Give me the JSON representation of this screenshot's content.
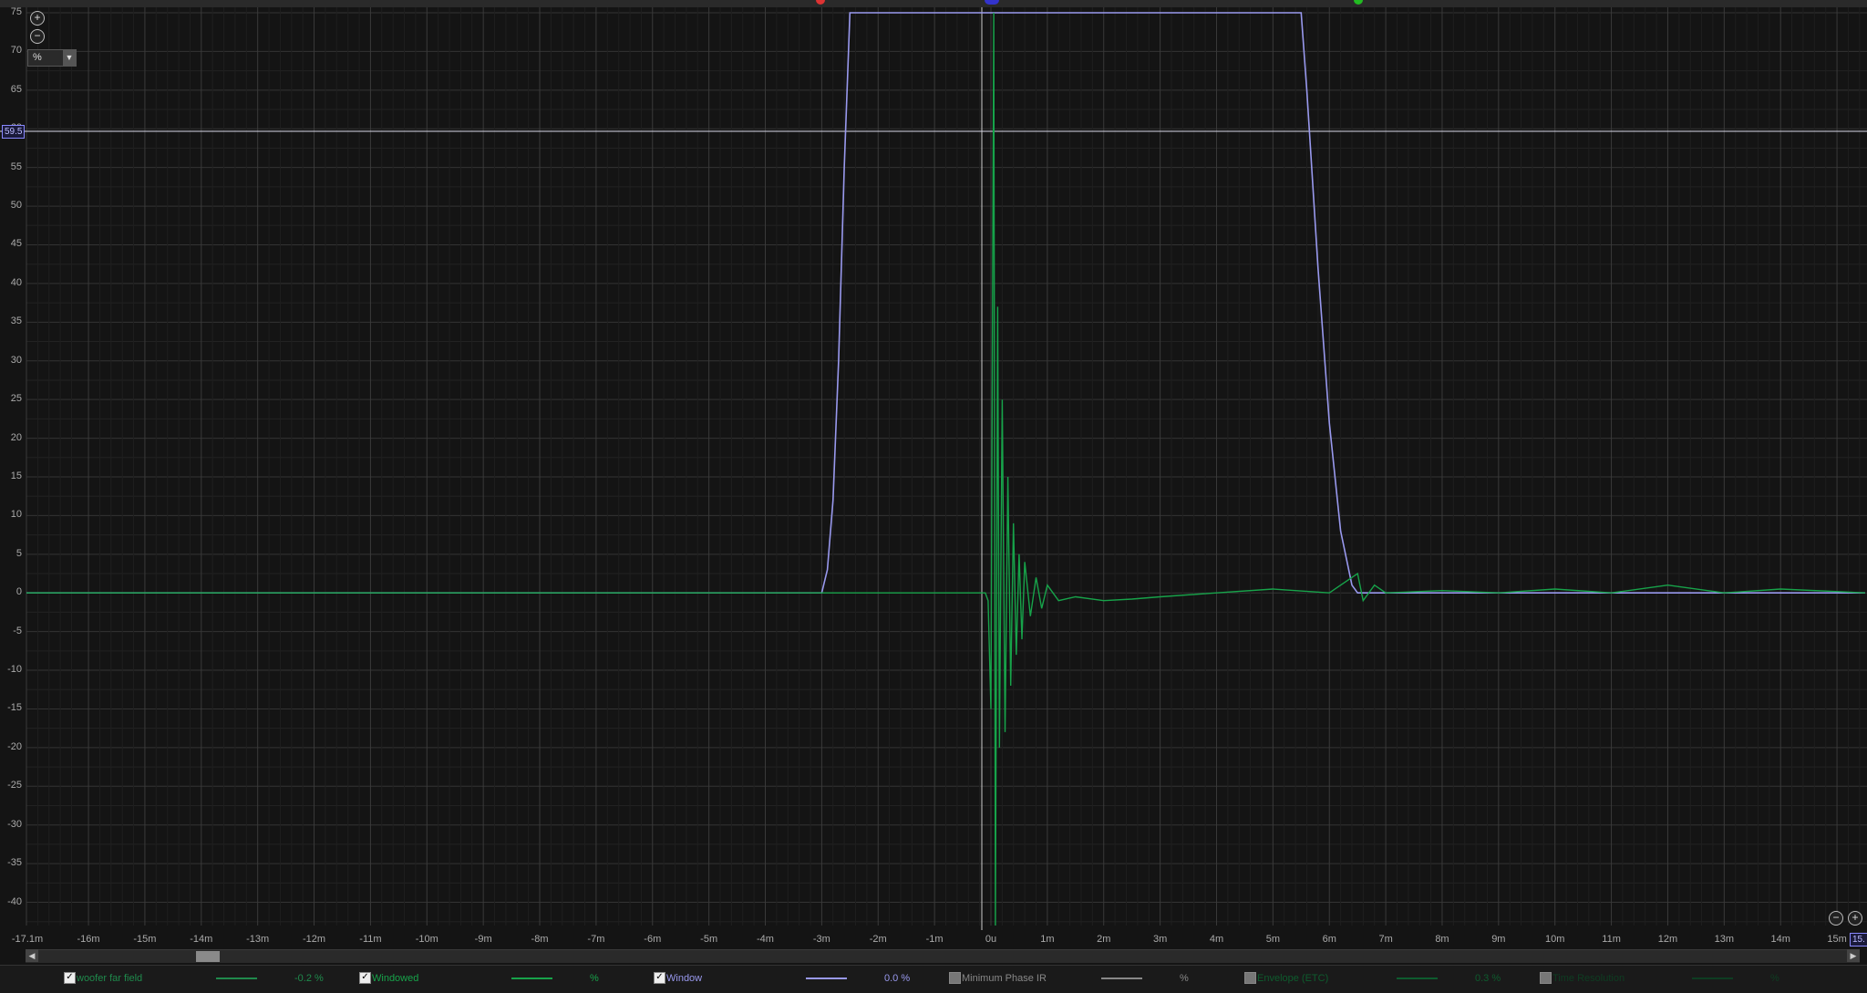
{
  "chart_data": {
    "type": "line",
    "xlabel": "",
    "ylabel": "",
    "xlim": [
      -17.1,
      15.5
    ],
    "ylim": [
      -43,
      75
    ],
    "x_ticks": [
      "-17.1m",
      "-16m",
      "-15m",
      "-14m",
      "-13m",
      "-12m",
      "-11m",
      "-10m",
      "-9m",
      "-8m",
      "-7m",
      "-6m",
      "-5m",
      "-4m",
      "-3m",
      "-2m",
      "-1m",
      "0u",
      "1m",
      "2m",
      "3m",
      "4m",
      "5m",
      "6m",
      "7m",
      "8m",
      "9m",
      "10m",
      "11m",
      "12m",
      "13m",
      "14m",
      "15m"
    ],
    "y_ticks": [
      "75",
      "70",
      "65",
      "60",
      "55",
      "50",
      "45",
      "40",
      "35",
      "30",
      "25",
      "20",
      "15",
      "10",
      "5",
      "0",
      "-5",
      "-10",
      "-15",
      "-20",
      "-25",
      "-30",
      "-35",
      "-40"
    ],
    "grid": true,
    "cursor_value": "59.5",
    "right_edge_label": "15.",
    "series": [
      {
        "name": "Window",
        "color": "#9999ee",
        "x": [
          -17.1,
          -3.0,
          -2.9,
          -2.8,
          -2.7,
          -2.6,
          -2.5,
          5.5,
          5.6,
          5.8,
          6.0,
          6.2,
          6.4,
          6.5,
          15.5
        ],
        "y": [
          0,
          0,
          3,
          12,
          30,
          55,
          75,
          75,
          65,
          42,
          22,
          8,
          1,
          0,
          0
        ]
      },
      {
        "name": "Windowed",
        "color": "#17a34a",
        "x": [
          -17.1,
          -0.1,
          -0.05,
          0.0,
          0.05,
          0.08,
          0.12,
          0.15,
          0.2,
          0.25,
          0.3,
          0.35,
          0.4,
          0.45,
          0.5,
          0.55,
          0.6,
          0.7,
          0.8,
          0.9,
          1.0,
          1.2,
          1.5,
          2.0,
          2.5,
          3.0,
          4.0,
          5.0,
          6.0,
          6.5,
          6.6,
          6.8,
          7.0,
          8.0,
          9.0,
          10.0,
          11.0,
          12.0,
          13.0,
          14.0,
          15.5
        ],
        "y": [
          0,
          0,
          -1,
          -15,
          75,
          -43,
          37,
          -20,
          25,
          -18,
          15,
          -12,
          9,
          -8,
          5,
          -6,
          4,
          -3,
          2,
          -2,
          1,
          -1,
          -0.5,
          -1,
          -0.8,
          -0.5,
          0,
          0.5,
          0,
          2.5,
          -1,
          1,
          0,
          0.3,
          0,
          0.5,
          0,
          1,
          0,
          0.5,
          0
        ]
      }
    ]
  },
  "legend": [
    {
      "label": "woofer far field",
      "value": "-0.2 %",
      "checked": true,
      "color": "#1f8a4c"
    },
    {
      "label": "Windowed",
      "value": "%",
      "checked": true,
      "color": "#17a34a"
    },
    {
      "label": "Window",
      "value": "0.0 %",
      "checked": true,
      "color": "#9999ee"
    },
    {
      "label": "Minimum Phase IR",
      "value": "%",
      "checked": false,
      "color": "#888888"
    },
    {
      "label": "Envelope (ETC)",
      "value": "0.3 %",
      "checked": false,
      "color": "#0e5c2e"
    },
    {
      "label": "Time Resolution",
      "value": "%",
      "checked": false,
      "color": "#0e3d22"
    }
  ],
  "controls": {
    "unit_select": "%",
    "zoom_in": "+",
    "zoom_out": "−"
  }
}
